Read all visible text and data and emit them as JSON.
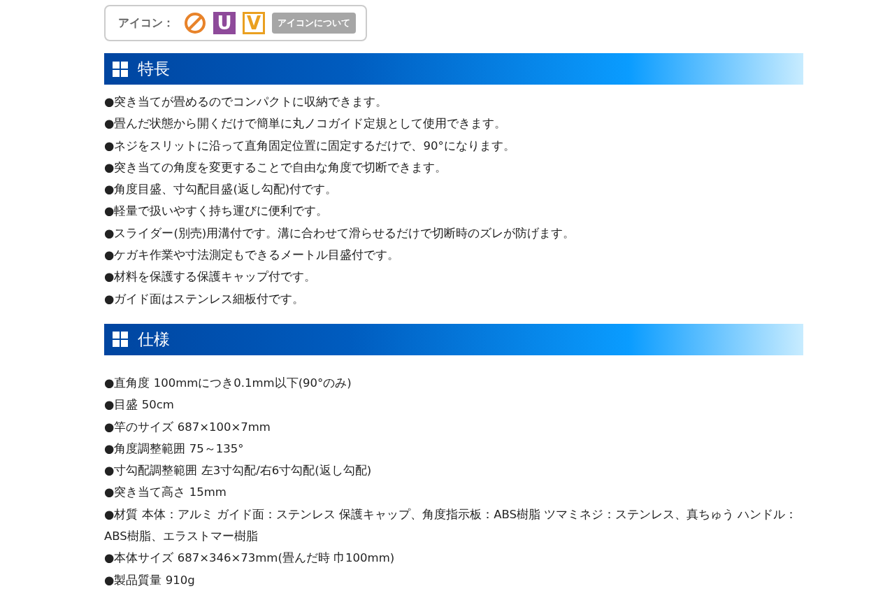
{
  "icon_legend": {
    "label": "アイコン：",
    "icons": [
      {
        "kind": "prohibited",
        "color": "#e8832a"
      },
      {
        "kind": "filled",
        "letter": "U",
        "color": "#8e4a9a"
      },
      {
        "kind": "outlined",
        "letter": "V",
        "color": "#eaa020"
      }
    ],
    "button": "アイコンについて"
  },
  "sections": [
    {
      "title": "特長",
      "items": [
        "●突き当てが畳めるのでコンパクトに収納できます。",
        "●畳んだ状態から開くだけで簡単に丸ノコガイド定規として使用できます。",
        "●ネジをスリットに沿って直角固定位置に固定するだけで、90°になります。",
        "●突き当ての角度を変更することで自由な角度で切断できます。",
        "●角度目盛、寸勾配目盛(返し勾配)付です。",
        "●軽量で扱いやすく持ち運びに便利です。",
        "●スライダー(別売)用溝付です。溝に合わせて滑らせるだけで切断時のズレが防げます。",
        "●ケガキ作業や寸法測定もできるメートル目盛付です。",
        "●材料を保護する保護キャップ付です。",
        "●ガイド面はステンレス細板付です。"
      ]
    },
    {
      "title": "仕様",
      "items": [
        "●直角度 100mmにつき0.1mm以下(90°のみ)",
        "●目盛 50cm",
        "●竿のサイズ 687×100×7mm",
        "●角度調整範囲 75～135°",
        "●寸勾配調整範囲 左3寸勾配/右6寸勾配(返し勾配)",
        "●突き当て高さ 15mm",
        "●材質 本体：アルミ ガイド面：ステンレス 保護キャップ、角度指示板：ABS樹脂 ツマミネジ：ステンレス、真ちゅう ハンドル：ABS樹脂、エラストマー樹脂",
        "●本体サイズ 687×346×73mm(畳んだ時 巾100mm)",
        "●製品質量 910g"
      ]
    }
  ]
}
